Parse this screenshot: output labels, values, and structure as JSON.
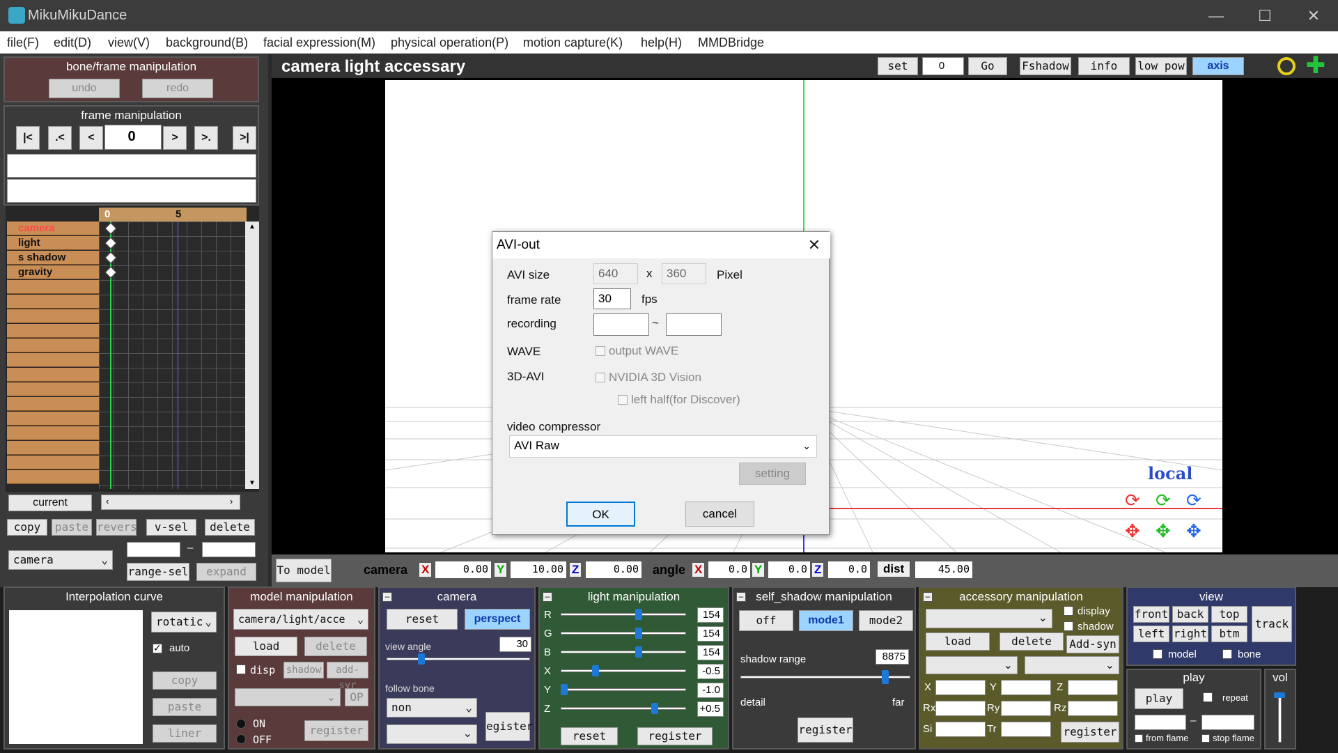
{
  "window": {
    "title": "MikuMikuDance"
  },
  "menu": [
    "file(F)",
    "edit(D)",
    "view(V)",
    "background(B)",
    "facial expression(M)",
    "physical operation(P)",
    "motion capture(K)",
    "help(H)",
    "MMDBridge"
  ],
  "bone_frame": {
    "title": "bone/frame manipulation",
    "undo": "undo",
    "redo": "redo"
  },
  "frame": {
    "title": "frame manipulation",
    "value": "0",
    "first": "|<",
    "prev_key": ".<",
    "prev": "<",
    "next": ">",
    "next_key": ">.",
    "last": ">|"
  },
  "timeline": {
    "rows": [
      "camera",
      "light",
      "s shadow",
      "gravity"
    ],
    "ticks": [
      "0",
      "5"
    ],
    "current": "current"
  },
  "frame_tools": {
    "copy": "copy",
    "paste": "paste",
    "revers": "revers",
    "vsel": "v-sel",
    "delete": "delete",
    "select": "camera",
    "range_sel": "range-sel",
    "expand": "expand",
    "dash": "–"
  },
  "viewport": {
    "title": "camera light accessary",
    "set": "set",
    "frame_value": "0",
    "go": "Go",
    "fshadow": "Fshadow",
    "info": "info",
    "low_pow": "low pow",
    "axis": "axis",
    "local": "local"
  },
  "dialog": {
    "title": "AVI-out",
    "avi_size": "AVI size",
    "width": "640",
    "x": "x",
    "height": "360",
    "pixel": "Pixel",
    "frame_rate": "frame rate",
    "fps_value": "30",
    "fps": "fps",
    "recording": "recording",
    "tilde": "~",
    "wave": "WAVE",
    "output_wave": "output WAVE",
    "avi3d": "3D-AVI",
    "nvidia": "NVIDIA 3D Vision",
    "left_half": "left half(for Discover)",
    "compressor_label": "video compressor",
    "compressor": "AVI Raw",
    "setting": "setting",
    "ok": "OK",
    "cancel": "cancel"
  },
  "camera_bar": {
    "to_model": "To model",
    "camera": "camera",
    "x": "X",
    "x_val": "0.00",
    "y": "Y",
    "y_val": "10.00",
    "z": "Z",
    "z_val": "0.00",
    "angle": "angle",
    "ax_val": "0.0",
    "ay_val": "0.0",
    "az_val": "0.0",
    "dist": "dist",
    "dist_val": "45.00"
  },
  "interp": {
    "title": "Interpolation curve",
    "select": "rotatic",
    "auto": "auto",
    "copy": "copy",
    "paste": "paste",
    "liner": "liner"
  },
  "model": {
    "title": "model manipulation",
    "select": "camera/light/acce",
    "load": "load",
    "delete": "delete",
    "disp": "disp",
    "shadow": "shadow",
    "add_syn": "add-syr",
    "op": "OP",
    "on": "ON",
    "off": "OFF",
    "register": "register"
  },
  "camera_panel": {
    "title": "camera",
    "reset": "reset",
    "perspect": "perspect",
    "view_angle": "view angle",
    "angle_val": "30",
    "follow_bone": "follow bone",
    "bone": "non",
    "register": "egister"
  },
  "light": {
    "title": "light manipulation",
    "r": "R",
    "g": "G",
    "b": "B",
    "x": "X",
    "y": "Y",
    "z": "Z",
    "r_val": "154",
    "g_val": "154",
    "b_val": "154",
    "x_val": "-0.5",
    "y_val": "-1.0",
    "z_val": "+0.5",
    "reset": "reset",
    "register": "register"
  },
  "shadow": {
    "title": "self_shadow manipulation",
    "off": "off",
    "mode1": "mode1",
    "mode2": "mode2",
    "range": "shadow range",
    "range_val": "8875",
    "detail": "detail",
    "far": "far",
    "register": "register"
  },
  "accessory": {
    "title": "accessory manipulation",
    "display": "display",
    "shadow": "shadow",
    "load": "load",
    "delete": "delete",
    "add_syn": "Add-syn",
    "x": "X",
    "y": "Y",
    "z": "Z",
    "rx": "Rx",
    "ry": "Ry",
    "rz": "Rz",
    "si": "Si",
    "tr": "Tr",
    "register": "register"
  },
  "view": {
    "title": "view",
    "front": "front",
    "back": "back",
    "top": "top",
    "track": "track",
    "left": "left",
    "right": "right",
    "btm": "btm",
    "model": "model",
    "bone": "bone"
  },
  "play": {
    "title": "play",
    "play": "play",
    "repeat": "repeat",
    "from_flame": "from flame",
    "stop_flame": "stop flame",
    "dash": "–"
  },
  "vol": {
    "title": "vol"
  }
}
